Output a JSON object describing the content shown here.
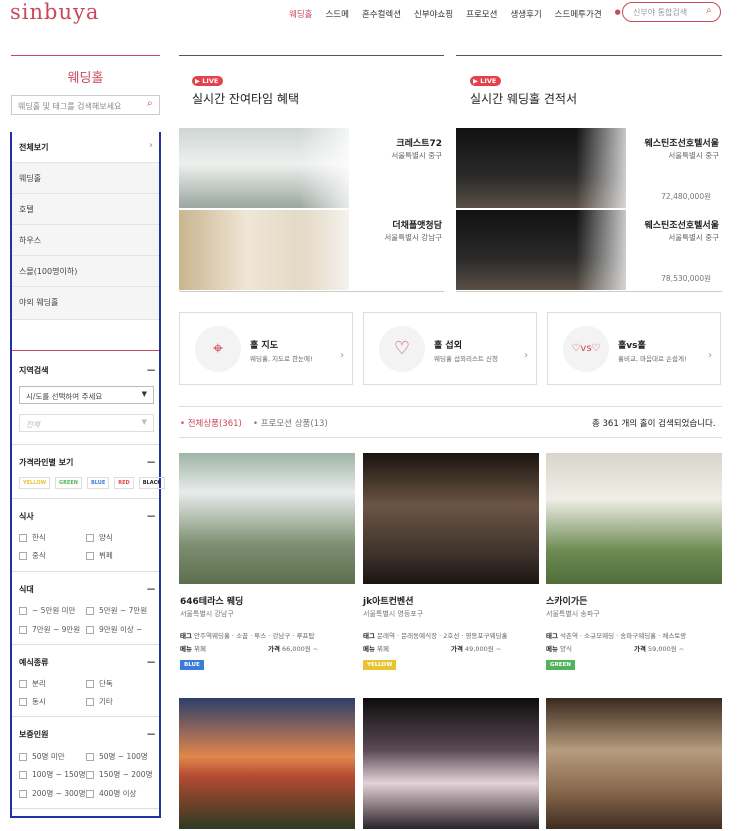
{
  "brand": {
    "logo": "sinbuya",
    "accent": "#c9485b"
  },
  "nav": {
    "items": [
      "웨딩홀",
      "스드메",
      "혼수컬렉션",
      "신부야쇼핑",
      "프로모션",
      "생생후기",
      "스드메투가견"
    ],
    "search_placeholder": "신부야 통합검색"
  },
  "sidebar": {
    "title": "웨딩홀",
    "search_placeholder": "웨딩홀 및 태그를 검색해보세요",
    "categories": [
      "전체보기",
      "웨딩홀",
      "호텔",
      "하우스",
      "스몰(100명이하)",
      "야외 웨딩홀"
    ],
    "region": {
      "title": "지역검색",
      "select1": "시/도를 선택하여 주세요",
      "select2": "전체"
    },
    "price_line": {
      "title": "가격라인별 보기",
      "chips": [
        "YELLOW",
        "GREEN",
        "BLUE",
        "RED",
        "BLACK"
      ]
    },
    "meal": {
      "title": "식사",
      "options": [
        "한식",
        "양식",
        "중식",
        "뷔페"
      ]
    },
    "meal_price": {
      "title": "식대",
      "options": [
        "~ 5만원 미만",
        "5만원 ~ 7만원",
        "7만원 ~ 9만원",
        "9만원 이상 ~"
      ]
    },
    "ceremony": {
      "title": "예식종류",
      "options": [
        "분리",
        "단독",
        "동시",
        "기타"
      ]
    },
    "guests": {
      "title": "보증인원",
      "options": [
        "50명 미만",
        "50명 ~ 100명",
        "100명 ~ 150명",
        "150명 ~ 200명",
        "200명 ~ 300명",
        "400명 이상"
      ]
    }
  },
  "live_left": {
    "badge": "LIVE",
    "title": "실시간 잔여타임 혜택",
    "items": [
      {
        "name": "크레스트72",
        "loc": "서울특별시 중구"
      },
      {
        "name": "더채플앳청담",
        "loc": "서울특별시 강남구"
      }
    ]
  },
  "live_right": {
    "badge": "LIVE",
    "title": "실시간 웨딩홀 견적서",
    "items": [
      {
        "name": "웨스틴조선호텔서울",
        "loc": "서울특별시 중구",
        "price": "72,480,000원"
      },
      {
        "name": "웨스틴조선호텔서울",
        "loc": "서울특별시 중구",
        "price": "78,530,000원"
      }
    ]
  },
  "features": [
    {
      "title": "홀 지도",
      "desc": "웨딩홀, 지도로 한눈에!"
    },
    {
      "title": "홀 섭외",
      "desc": "웨딩홀 섭외리스트 신청"
    },
    {
      "title": "홀vs홀",
      "desc": "홀비교, 마음대로 손쉽게!"
    }
  ],
  "tabs": {
    "all": "• 전체상품(361)",
    "promo": "• 프로모션 상품(13)",
    "count": "총 361 개의 홀이 검색되었습니다."
  },
  "products": [
    {
      "name": "646테라스 웨딩",
      "loc": "서울특별시 강남구",
      "tag_label": "태그",
      "tags": "안주역웨딩홀 · 소꿉 · 투스 · 강남구 · 루프탑",
      "menu_label": "메뉴",
      "menu": "뷔페",
      "price_label": "가격",
      "price": "66,000원 ~",
      "badge": "BLUE"
    },
    {
      "name": "jk아트컨벤션",
      "loc": "서울특별시 영등포구",
      "tag_label": "태그",
      "tags": "문래역 · 문래동예식장 · 2호선 · 영등포구웨딩홀",
      "menu_label": "메뉴",
      "menu": "뷔페",
      "price_label": "가격",
      "price": "49,000원 ~",
      "badge": "YELLOW"
    },
    {
      "name": "스카이가든",
      "loc": "서울특별시 송파구",
      "tag_label": "태그",
      "tags": "석촌역 · 소규모웨딩 · 송파구웨딩홀 · 채스토랑",
      "menu_label": "메뉴",
      "menu": "양식",
      "price_label": "가격",
      "price": "59,000원 ~",
      "badge": "GREEN"
    }
  ],
  "badge_colors": {
    "BLUE": "#3b7bd9",
    "YELLOW": "#e8c431",
    "GREEN": "#4fb45a",
    "RED": "#e04a4a",
    "BLACK": "#222222"
  }
}
